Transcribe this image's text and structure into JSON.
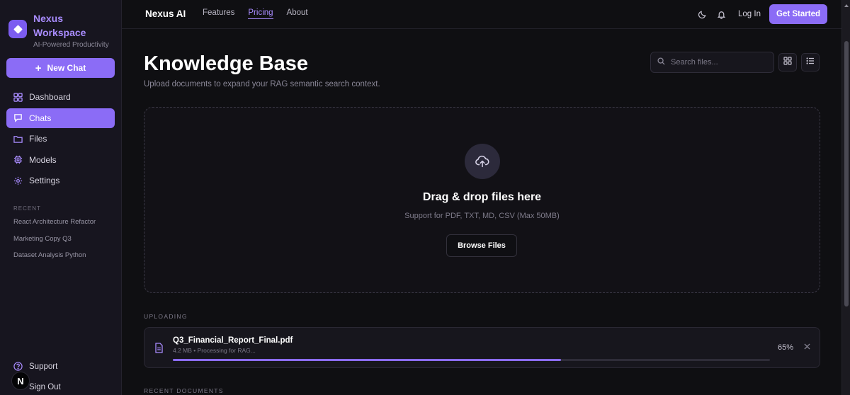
{
  "sidebar": {
    "brand_title": "Nexus Workspace",
    "brand_subtitle": "AI-Powered Productivity",
    "new_chat_label": "New Chat",
    "items": [
      {
        "label": "Dashboard",
        "icon": "dashboard-icon",
        "active": false
      },
      {
        "label": "Chats",
        "icon": "chat-icon",
        "active": true
      },
      {
        "label": "Files",
        "icon": "folder-icon",
        "active": false
      },
      {
        "label": "Models",
        "icon": "cpu-icon",
        "active": false
      },
      {
        "label": "Settings",
        "icon": "gear-icon",
        "active": false
      }
    ],
    "recent_label": "RECENT",
    "recent": [
      "React Architecture Refactor",
      "Marketing Copy Q3",
      "Dataset Analysis Python"
    ],
    "support_label": "Support",
    "signout_label": "Sign Out",
    "avatar_letter": "N"
  },
  "topbar": {
    "logo": "Nexus AI",
    "nav": [
      {
        "label": "Features",
        "active": false
      },
      {
        "label": "Pricing",
        "active": true
      },
      {
        "label": "About",
        "active": false
      }
    ],
    "login_label": "Log In",
    "cta_label": "Get Started"
  },
  "main": {
    "title": "Knowledge Base",
    "subtitle": "Upload documents to expand your RAG semantic search context.",
    "search_placeholder": "Search files...",
    "dropzone": {
      "title": "Drag & drop files here",
      "subtitle": "Support for PDF, TXT, MD, CSV (Max 50MB)",
      "browse_label": "Browse Files"
    },
    "uploading_label": "UPLOADING",
    "upload": {
      "file_name": "Q3_Financial_Report_Final.pdf",
      "meta": "4.2 MB • Processing for RAG...",
      "progress_percent": 65,
      "progress_text": "65%"
    },
    "recent_docs_label": "RECENT DOCUMENTS"
  },
  "colors": {
    "accent": "#8b6cf6",
    "accent_text": "#a98cff",
    "background": "#0f0f12",
    "sidebar": "#17151f"
  }
}
